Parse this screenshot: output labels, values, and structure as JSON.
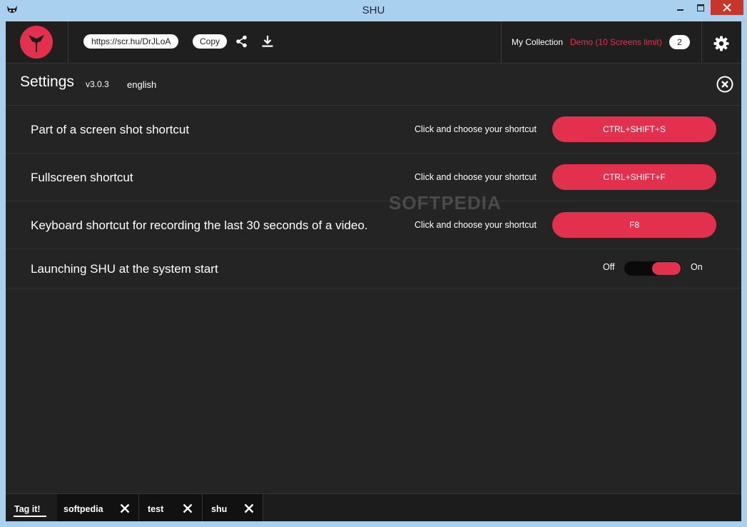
{
  "window": {
    "title": "SHU",
    "icons": {
      "app": "shu-app-icon",
      "minimize": "minimize-icon",
      "maximize": "maximize-icon",
      "close": "close-icon"
    }
  },
  "topbar": {
    "url": "https://scr.hu/DrJLoA",
    "copy_label": "Copy",
    "share_icon": "share-icon",
    "download_icon": "download-icon",
    "collection_label": "My Collection",
    "demo_label": "Demo (10 Screens limit)",
    "count": "2",
    "settings_icon": "gear-icon"
  },
  "settings": {
    "title": "Settings",
    "version": "v3.0.3",
    "language": "english",
    "close_icon": "close-circle-icon",
    "rows": [
      {
        "label": "Part of a screen shot shortcut",
        "hint": "Click and choose your shortcut",
        "shortcut": "CTRL+SHIFT+S"
      },
      {
        "label": "Fullscreen shortcut",
        "hint": "Click and choose your shortcut",
        "shortcut": "CTRL+SHIFT+F"
      },
      {
        "label": "Keyboard shortcut for recording the last 30 seconds of a video.",
        "hint": "Click and choose your shortcut",
        "shortcut": "F8"
      }
    ],
    "startup": {
      "label": "Launching SHU at the system start",
      "off_label": "Off",
      "on_label": "On",
      "state": "on"
    }
  },
  "watermark": "SOFTPEDIA",
  "tagbar": {
    "tag_it": "Tag it!",
    "tags": [
      "softpedia",
      "test",
      "shu"
    ]
  },
  "colors": {
    "accent": "#e4304f",
    "background": "#242424",
    "titlebar": "#a9d0ef"
  }
}
